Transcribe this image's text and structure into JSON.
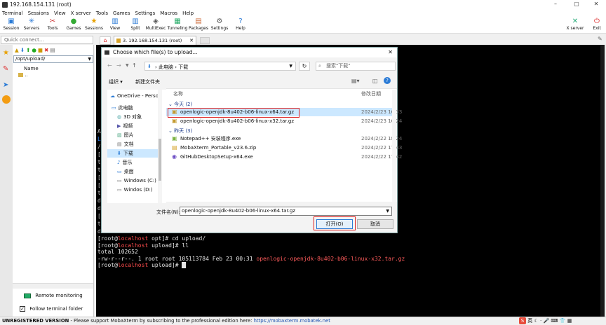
{
  "window": {
    "title": "192.168.154.131 (root)"
  },
  "menu": [
    "Terminal",
    "Sessions",
    "View",
    "X server",
    "Tools",
    "Games",
    "Settings",
    "Macros",
    "Help"
  ],
  "toolbar": [
    "Session",
    "Servers",
    "Tools",
    "Games",
    "Sessions",
    "View",
    "Split",
    "MultiExec",
    "Tunneling",
    "Packages",
    "Settings",
    "Help"
  ],
  "toolbar_right": [
    "X server",
    "Exit"
  ],
  "sidebar": {
    "quick_connect_placeholder": "Quick connect...",
    "path": "/opt/upload/",
    "column_name": "Name",
    "parent_item": "..",
    "remote_monitoring": "Remote monitoring",
    "follow_terminal_folder": "Follow terminal folder"
  },
  "tabs": {
    "active": "3. 192.168.154.131 (root)"
  },
  "terminal_lines": [
    {
      "prompt_user": "[root@",
      "host": "localhost",
      "rest": " opt]# cd upload/"
    },
    {
      "prompt_user": "[root@",
      "host": "localhost",
      "rest": " upload]# ll"
    },
    {
      "plain": "total 102652"
    },
    {
      "plain": "-rw-r--r--. 1 root root 105113784 Feb 23 00:31 ",
      "file": "openlogic-openjdk-8u402-b06-linux-x32.tar.gz"
    },
    {
      "prompt_user": "[root@",
      "host": "localhost",
      "rest": " upload]# "
    }
  ],
  "dialog": {
    "title": "Choose which file(s) to upload...",
    "breadcrumb": [
      "此电脑",
      "下载"
    ],
    "search_placeholder": "搜索\"下载\"",
    "organize": "组织 ▾",
    "new_folder": "新建文件夹",
    "col_name": "名称",
    "col_modified": "修改日期",
    "nav": [
      "OneDrive - Perso",
      "此电脑",
      "3D 对象",
      "视频",
      "图片",
      "文档",
      "下载",
      "音乐",
      "桌面",
      "Windows (C:)",
      "Windos (D:)"
    ],
    "groups": [
      {
        "label": "今天 (2)",
        "files": [
          {
            "name": "openlogic-openjdk-8u402-b06-linux-x64.tar.gz",
            "date": "2024/2/23 16:33",
            "selected": true
          },
          {
            "name": "openlogic-openjdk-8u402-b06-linux-x32.tar.gz",
            "date": "2024/2/23 16:24",
            "selected": false
          }
        ]
      },
      {
        "label": "昨天 (3)",
        "files": [
          {
            "name": "Notepad++ 安装程序.exe",
            "date": "2024/2/22 18:24"
          },
          {
            "name": "MobaXterm_Portable_v23.6.zip",
            "date": "2024/2/22 17:43"
          },
          {
            "name": "GitHubDesktopSetup-x64.exe",
            "date": "2024/2/22 17:42"
          }
        ]
      }
    ],
    "filename_label": "文件名(N):",
    "filename_value": "openlogic-openjdk-8u402-b06-linux-x64.tar.gz",
    "open_button": "打开(O)",
    "cancel_button": "取消"
  },
  "status_bar": {
    "bold": "UNREGISTERED VERSION",
    "text": "  -  Please support MobaXterm by subscribing to the professional edition here: ",
    "link": "https://mobaxterm.mobatek.net"
  },
  "tray": [
    "英"
  ],
  "colors": {
    "accent": "#1e6fd9",
    "host_red": "#ff4d4d",
    "file_red": "#ff5c5c",
    "selection": "#cce8ff",
    "highlight_box": "#dd2222"
  }
}
